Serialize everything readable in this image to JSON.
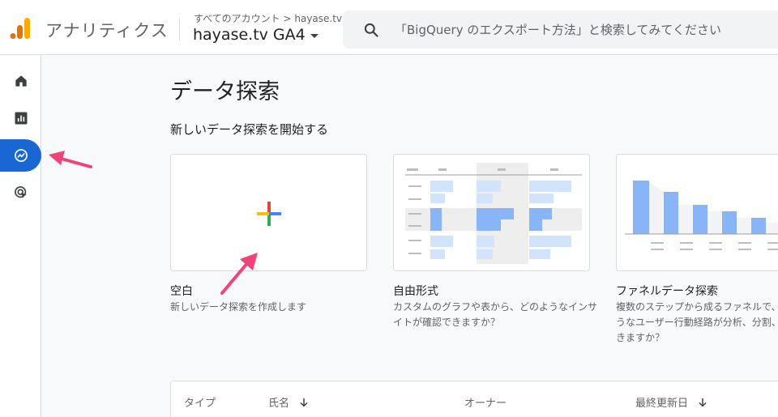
{
  "header": {
    "app_title": "アナリティクス",
    "breadcrumb": "すべてのアカウント > hayase.tv",
    "property": "hayase.tv GA4",
    "search_placeholder": "「BigQuery のエクスポート方法」と検索してみてください",
    "logo_colors": [
      "#f9ab00",
      "#e37400",
      "#e37400"
    ]
  },
  "nav": {
    "items": [
      {
        "icon": "home-icon",
        "active": false
      },
      {
        "icon": "reports-icon",
        "active": false
      },
      {
        "icon": "explore-icon",
        "active": true
      },
      {
        "icon": "advertising-icon",
        "active": false
      }
    ],
    "active_color": "#1967d2"
  },
  "main": {
    "title": "データ探索",
    "section_title": "新しいデータ探索を開始する",
    "cards": [
      {
        "label": "空白",
        "description": "新しいデータ探索を作成します",
        "icon": "plus-icon"
      },
      {
        "label": "自由形式",
        "description": "カスタムのグラフや表から、どのようなインサイトが確認できますか？",
        "icon": "free-form-thumbnail"
      },
      {
        "label": "ファネルデータ探索",
        "description": "複数のステップから成るファネルで、ユーザーがどのようなユーザー行動経路が分析、分割、",
        "description_lines": [
          "複数のステップから成るファネルで、ユ",
          "うなユーザー行動経路が分析、分割、",
          "きますか？"
        ],
        "icon": "funnel-thumbnail"
      }
    ],
    "table_headers": [
      "タイプ",
      "氏名",
      "オーナー",
      "最終更新日"
    ]
  },
  "annotations": {
    "arrow_color": "#f0437a"
  }
}
